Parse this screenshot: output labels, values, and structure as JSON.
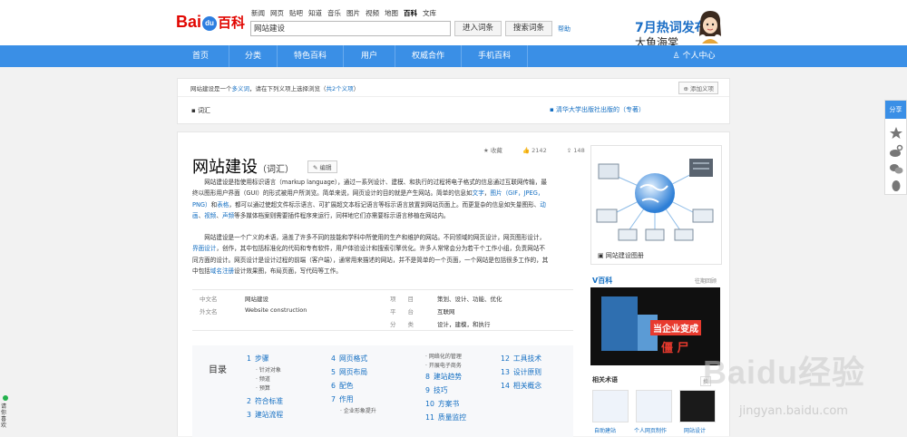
{
  "header": {
    "logo_text": "Bai",
    "logo_paw": "du",
    "logo_suffix": "百科",
    "top_links": [
      "新闻",
      "网页",
      "贴吧",
      "知道",
      "音乐",
      "图片",
      "视频",
      "地图",
      "百科",
      "文库"
    ],
    "active_link_index": 8,
    "search_value": "网站建设",
    "enter_button": "进入词条",
    "search_button": "搜索词条",
    "help": "帮助",
    "promo_line1": "7月热词发布",
    "promo_line2": "大鱼海棠"
  },
  "nav": {
    "items": [
      "首页",
      "分类",
      "特色百科",
      "用户",
      "权威合作",
      "手机百科"
    ],
    "user_center": "个人中心",
    "background": "#3a8fe6"
  },
  "polysemy": {
    "prefix": "网站建设是一个",
    "link": "多义词",
    "mid": "，请在下列义项上选择浏览（",
    "count": "共2个义项",
    "suffix": "）",
    "add_button": "添加义项",
    "sense1": "词汇",
    "sense2": "清华大学出版社出版的（专著）"
  },
  "article": {
    "title": "网站建设",
    "title_tag": "（词汇）",
    "edit": "编辑",
    "favorite": "收藏",
    "likes": "2142",
    "shares": "148",
    "para1": [
      {
        "t": "网站建设是指使用标识语言（markup language），通过一系列设计、建模、和执行的过程将电子格式的信息通过互联网传输，最终以图形用户界面（GUI）的形式被用户所浏览。简单来说，网页设计的目的就是产生网站。简单的信息如"
      },
      {
        "t": "文字",
        "link": true
      },
      {
        "t": "，"
      },
      {
        "t": "图片（GIF，JPEG，PNG）",
        "link": true
      },
      {
        "t": "和"
      },
      {
        "t": "表格",
        "link": true
      },
      {
        "t": "，都可以通过使超文件标示语言、可扩展超文本标记语言等标示语言放置到网站页面上。而更复杂的信息如矢量图形、"
      },
      {
        "t": "动画",
        "link": true
      },
      {
        "t": "、"
      },
      {
        "t": "视频",
        "link": true
      },
      {
        "t": "、"
      },
      {
        "t": "声频",
        "link": true
      },
      {
        "t": "等多媒体档案则需要插件程序来运行，同样地它们亦需要标示语言移植在网站内。"
      }
    ],
    "para2": [
      {
        "t": "网站建设是一个广义的术语，涵盖了许多不同的技能和学科中所使用的生产和维护的网站。不同领域的网页设计，网页图形设计，"
      },
      {
        "t": "界面设计",
        "link": true
      },
      {
        "t": "，创作，其中包括标准化的代码和专有软件，用户体验设计和搜索引擎优化。许多人常常会分为若干个工作小组，负责网站不同方面的设计。网页设计是设计过程的前端（客户端），通常用来描述的网站，并不是简单的一个页面，一个网站是包括很多工作的，其中包括"
      },
      {
        "t": "域名注册",
        "link": true
      },
      {
        "t": "设计效果图，布局页面，写代码等工作。"
      }
    ]
  },
  "basic_info": {
    "rows": [
      {
        "k1": "中文名",
        "v1": "网站建设",
        "k2": "项　　目",
        "v2": "策划、设计、功能、优化"
      },
      {
        "k1": "外文名",
        "v1": "Website construction",
        "k2": "平　　台",
        "v2": "互联网"
      },
      {
        "k1": "",
        "v1": "",
        "k2": "分　　类",
        "v2": "设计，建模，和执行"
      }
    ]
  },
  "toc": {
    "title": "目录",
    "items": [
      {
        "n": "1",
        "t": "步骤"
      },
      {
        "n": "2",
        "t": "符合标准"
      },
      {
        "n": "3",
        "t": "建站流程"
      },
      {
        "n": "4",
        "t": "网页格式"
      },
      {
        "n": "5",
        "t": "网页布局"
      },
      {
        "n": "6",
        "t": "配色"
      },
      {
        "n": "7",
        "t": "作用"
      },
      {
        "n": "8",
        "t": "建站趋势"
      },
      {
        "n": "9",
        "t": "技巧"
      },
      {
        "n": "10",
        "t": "方案书"
      },
      {
        "n": "11",
        "t": "质量监控"
      },
      {
        "n": "12",
        "t": "工具技术"
      },
      {
        "n": "13",
        "t": "设计原则"
      },
      {
        "n": "14",
        "t": "相关概念"
      }
    ],
    "subs": [
      "针对对象",
      "频道",
      "预算",
      "企业形象提升",
      "网络化的管理",
      "开展电子商务"
    ]
  },
  "sidebar": {
    "image_caption": "网站建设图册",
    "vbaike_title": "V百科",
    "vbaike_more": "往期回顾",
    "ad_text1": "当企业变成",
    "ad_text2": "僵 尸",
    "related_title": "相关术语",
    "related_more": "换",
    "related": [
      "自助建站",
      "个人网页制作",
      "网站设计"
    ]
  },
  "rail": {
    "share": "分享"
  },
  "left_float": {
    "text": "请你喜欢"
  },
  "watermark": {
    "line1": "Baidu经验",
    "line2": "jingyan.baidu.com"
  }
}
